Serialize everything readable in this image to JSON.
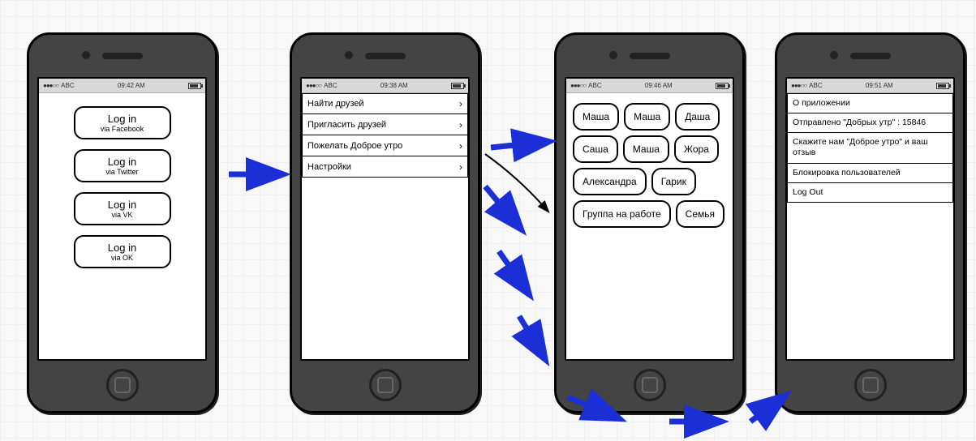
{
  "status": {
    "signal_dots": "●●●○○",
    "carrier": "ABC"
  },
  "phone1": {
    "time": "09:42 AM",
    "login_title": "Log in",
    "buttons": [
      {
        "sub": "via Facebook"
      },
      {
        "sub": "via Twitter"
      },
      {
        "sub": "via VK"
      },
      {
        "sub": "via OK"
      }
    ]
  },
  "phone2": {
    "time": "09:38 AM",
    "menu": [
      "Найти друзей",
      "Пригласить друзей",
      "Пожелать Доброе утро",
      "Настройки"
    ]
  },
  "phone3": {
    "time": "09:46 AM",
    "chips": [
      "Маша",
      "Маша",
      "Даша",
      "Саша",
      "Маша",
      "Жора",
      "Александра",
      "Гарик",
      "Группа на работе",
      "Семья"
    ]
  },
  "phone4": {
    "time": "09:51 AM",
    "rows": [
      "О приложении",
      "Отправлено \"Добрых утр\" : 15846",
      "Скажите нам \"Доброе утро\" и ваш отзыв",
      "Блокировка пользователей",
      "Log Out"
    ]
  }
}
